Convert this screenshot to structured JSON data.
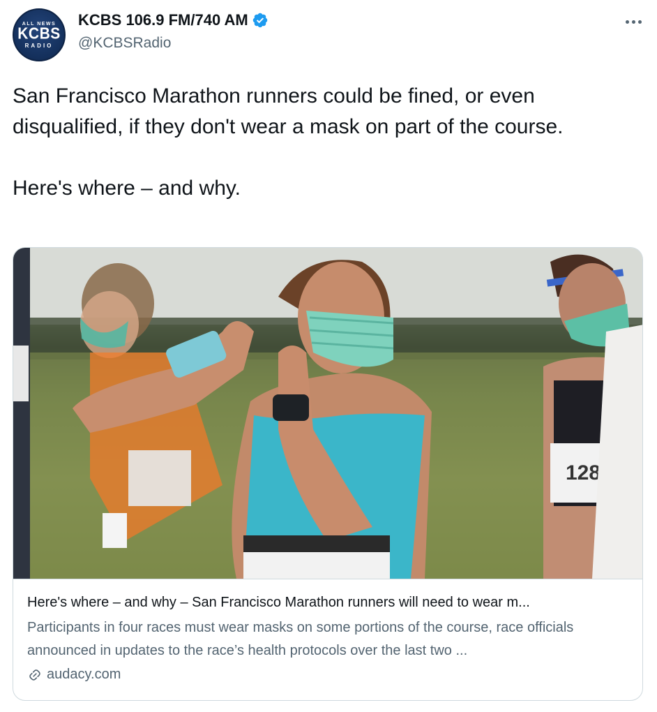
{
  "author": {
    "display_name": "KCBS 106.9 FM/740 AM",
    "handle": "@KCBSRadio",
    "avatar": {
      "top_text": "ALL NEWS",
      "main_text": "KCBS",
      "bottom_text": "RADIO"
    },
    "verified": true
  },
  "icons": {
    "verified": "verified-badge-icon",
    "more": "more-options-icon",
    "link": "link-icon"
  },
  "tweet": {
    "text": "San Francisco Marathon runners could be fined, or even disqualified, if they don't wear a mask on part of the course.\n\nHere's where – and why."
  },
  "card": {
    "title": "Here's where – and why – San Francisco Marathon runners will need to wear m...",
    "description": "Participants in four races must wear masks on some portions of the course, race officials announced in updates to the race’s health protocols over the last two ...",
    "domain": "audacy.com",
    "image_bib_number": "128"
  },
  "colors": {
    "text_primary": "#0f1419",
    "text_secondary": "#536471",
    "verified_blue": "#1d9bf0",
    "card_border": "#cfd9de"
  }
}
